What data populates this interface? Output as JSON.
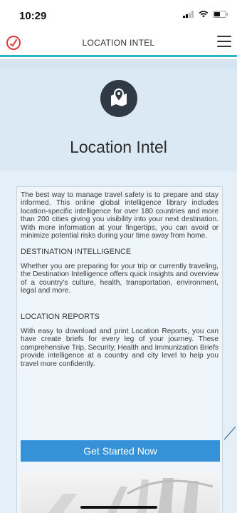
{
  "status_bar": {
    "time": "10:29",
    "icons": [
      "signal-icon",
      "wifi-icon",
      "battery-icon"
    ]
  },
  "header": {
    "title": "LOCATION INTEL",
    "logo_icon": "logo-icon",
    "menu_icon": "hamburger-menu-icon"
  },
  "hero": {
    "icon": "map-pin-icon",
    "title": "Location Intel"
  },
  "content": {
    "intro": "The best way to manage travel safety is to prepare and stay informed. This online global intelligence library includes location-specific intelligence for over 180 countries and more than 200 cities giving you visibility into your next destination. With more information at your fingertips, you can avoid or minimize potential risks during your time away from home.",
    "sections": [
      {
        "heading": "DESTINATION INTELLIGENCE",
        "body": "Whether you are preparing for your trip or currently traveling, the Destination Intelligence offers quick insights and overview of a country's culture, health, transportation, environment, legal and more."
      },
      {
        "heading": "LOCATION REPORTS",
        "body": "With easy to download and print Location Reports, you can have create briefs for every leg of your journey. These comprehensive Trip, Security, Health and Immunization Briefs provide intelligence at a country and city level to help you travel more confidently."
      }
    ],
    "cta_label": "Get Started Now"
  },
  "colors": {
    "accent": "#2bb6c8",
    "button": "#3592d8",
    "logo": "#e03a3a",
    "hero_bg": "#dbe9f4"
  }
}
